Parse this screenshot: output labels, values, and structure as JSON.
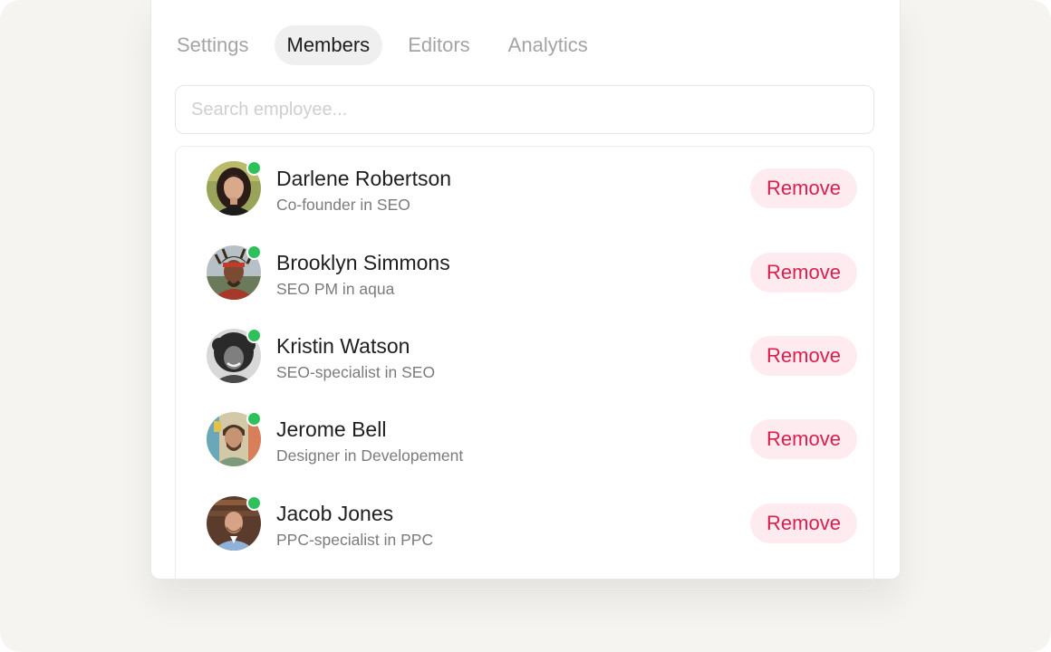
{
  "tabs": [
    {
      "label": "Settings",
      "active": false
    },
    {
      "label": "Members",
      "active": true
    },
    {
      "label": "Editors",
      "active": false
    },
    {
      "label": "Analytics",
      "active": false
    }
  ],
  "search": {
    "placeholder": "Search employee..."
  },
  "members": [
    {
      "name": "Darlene Robertson",
      "role": "Co-founder in SEO",
      "online": true,
      "action": "Remove"
    },
    {
      "name": "Brooklyn Simmons",
      "role": "SEO PM in aqua",
      "online": true,
      "action": "Remove"
    },
    {
      "name": "Kristin Watson",
      "role": "SEO-specialist in SEO",
      "online": true,
      "action": "Remove"
    },
    {
      "name": "Jerome Bell",
      "role": "Designer in Developement",
      "online": true,
      "action": "Remove"
    },
    {
      "name": "Jacob Jones",
      "role": "PPC-specialist in PPC",
      "online": true,
      "action": "Remove"
    }
  ],
  "colors": {
    "online": "#2ec05b",
    "remove_text": "#db1e4c",
    "remove_bg": "#fdebf0",
    "active_tab_bg": "#efefef"
  }
}
